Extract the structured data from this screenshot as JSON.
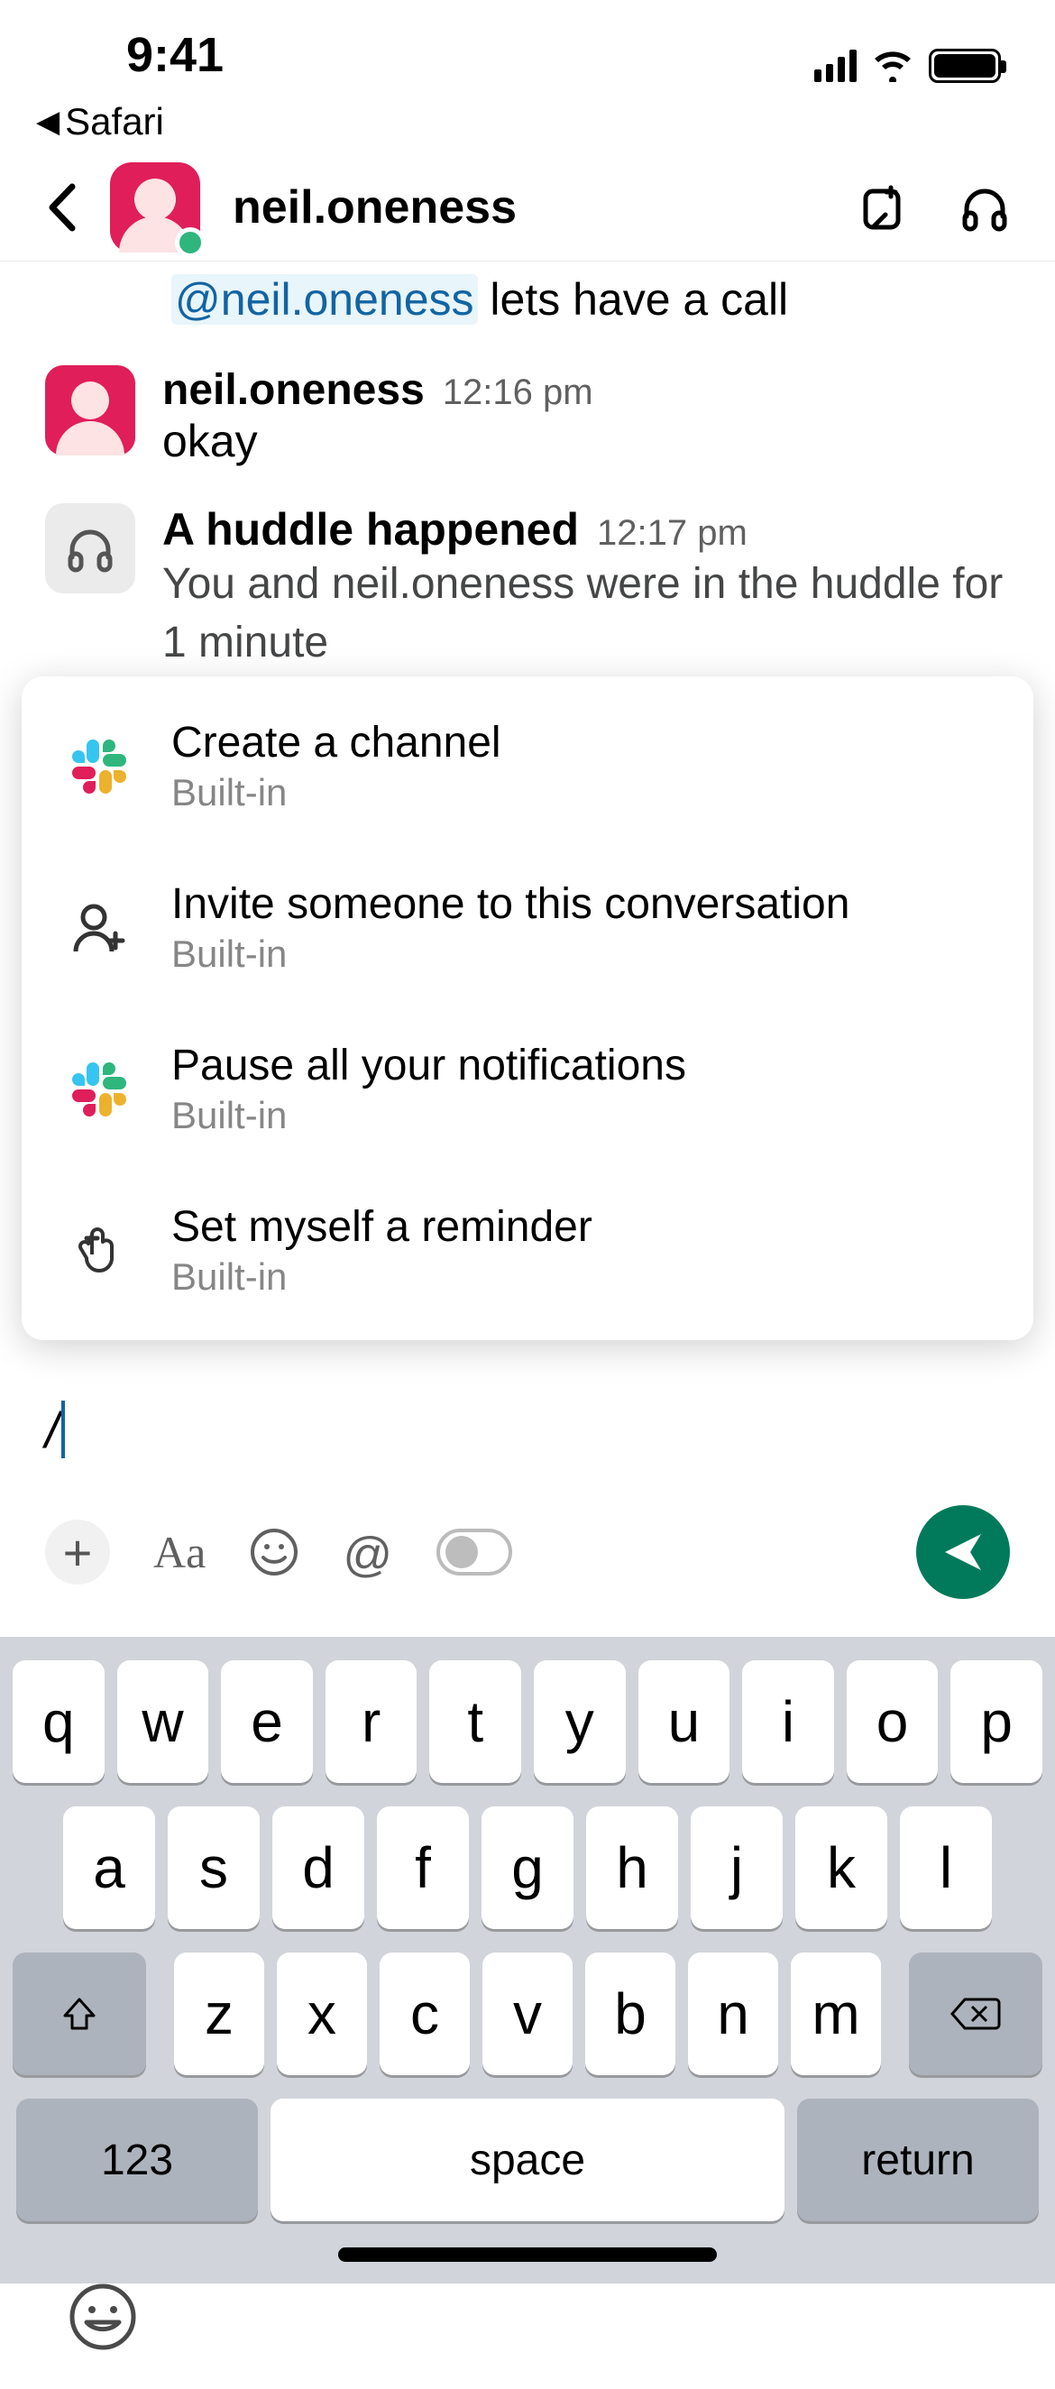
{
  "status": {
    "time": "9:41",
    "back_app": "Safari"
  },
  "header": {
    "title": "neil.oneness"
  },
  "chat": {
    "mention": "@neil.oneness",
    "mention_suffix": " lets have a call",
    "msg1": {
      "sender": "neil.oneness",
      "time": "12:16 pm",
      "text": "okay"
    },
    "huddle": {
      "title": "A huddle happened",
      "time": "12:17 pm",
      "desc": "You and neil.oneness were in the huddle for 1 minute"
    }
  },
  "popup": {
    "items": [
      {
        "title": "Create a channel",
        "sub": "Built-in",
        "icon": "slack"
      },
      {
        "title": "Invite someone to this conversation",
        "sub": "Built-in",
        "icon": "invite"
      },
      {
        "title": "Pause all your notifications",
        "sub": "Built-in",
        "icon": "slack"
      },
      {
        "title": "Set myself a reminder",
        "sub": "Built-in",
        "icon": "remind"
      }
    ]
  },
  "input": {
    "text": "/"
  },
  "keyboard": {
    "row1": [
      "q",
      "w",
      "e",
      "r",
      "t",
      "y",
      "u",
      "i",
      "o",
      "p"
    ],
    "row2": [
      "a",
      "s",
      "d",
      "f",
      "g",
      "h",
      "j",
      "k",
      "l"
    ],
    "row3": [
      "z",
      "x",
      "c",
      "v",
      "b",
      "n",
      "m"
    ],
    "numeric": "123",
    "space": "space",
    "return": "return"
  }
}
